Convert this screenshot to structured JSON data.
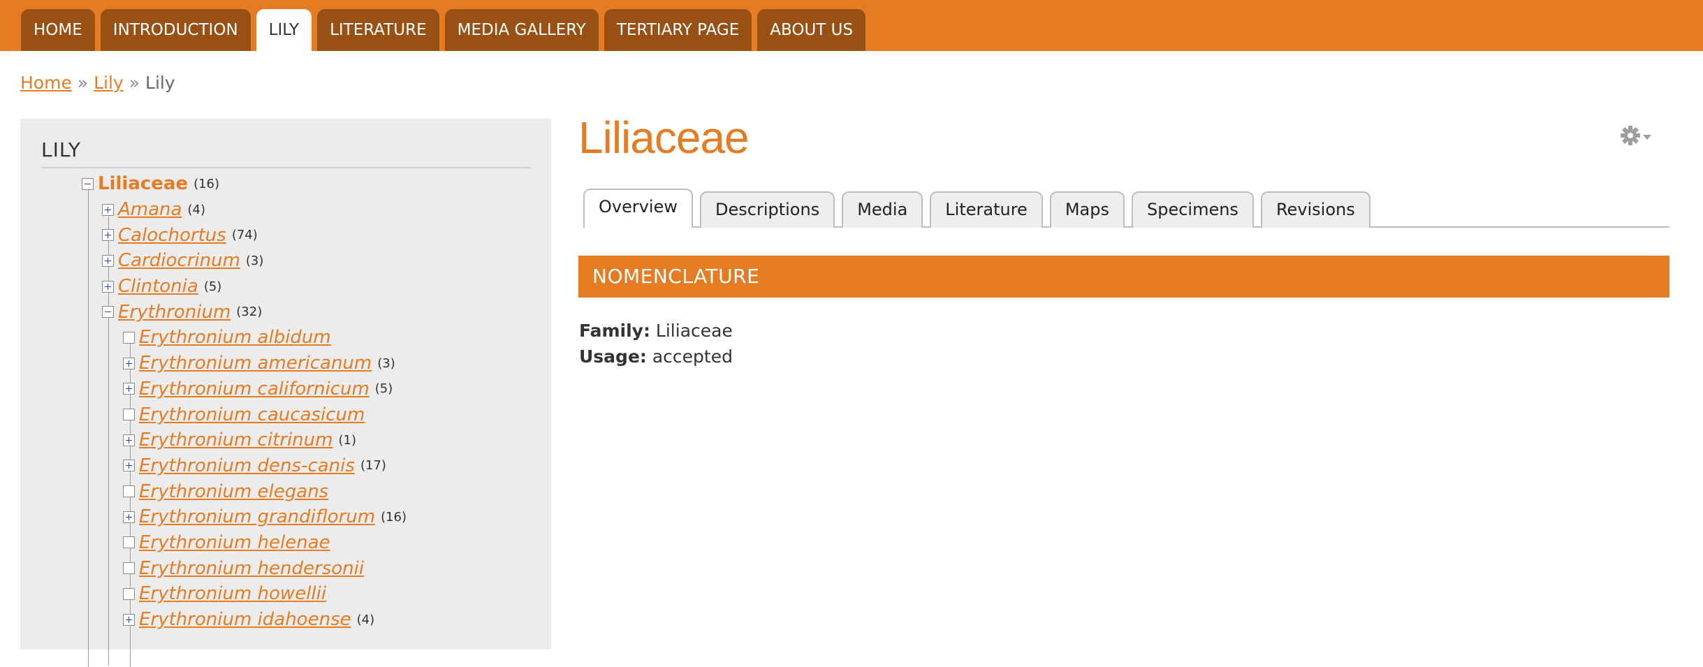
{
  "nav": {
    "tabs": [
      {
        "label": "HOME",
        "active": false
      },
      {
        "label": "INTRODUCTION",
        "active": false
      },
      {
        "label": "LILY",
        "active": true
      },
      {
        "label": "LITERATURE",
        "active": false
      },
      {
        "label": "MEDIA GALLERY",
        "active": false
      },
      {
        "label": "TERTIARY PAGE",
        "active": false
      },
      {
        "label": "ABOUT US",
        "active": false
      }
    ]
  },
  "breadcrumb": {
    "home": "Home",
    "lily_link": "Lily",
    "sep": "»",
    "current": "Lily"
  },
  "tree": {
    "title": "LILY",
    "root": {
      "label": "Liliaceae",
      "count": "(16)",
      "expander": "minus"
    },
    "genera": [
      {
        "label": "Amana",
        "count": "(4)",
        "expander": "plus"
      },
      {
        "label": "Calochortus",
        "count": "(74)",
        "expander": "plus"
      },
      {
        "label": "Cardiocrinum",
        "count": "(3)",
        "expander": "plus"
      },
      {
        "label": "Clintonia",
        "count": "(5)",
        "expander": "plus"
      },
      {
        "label": "Erythronium",
        "count": "(32)",
        "expander": "minus"
      }
    ],
    "species": [
      {
        "label": "Erythronium albidum",
        "count": "",
        "expander": "leaf"
      },
      {
        "label": "Erythronium americanum",
        "count": "(3)",
        "expander": "plus"
      },
      {
        "label": "Erythronium californicum",
        "count": "(5)",
        "expander": "plus"
      },
      {
        "label": "Erythronium caucasicum",
        "count": "",
        "expander": "leaf"
      },
      {
        "label": "Erythronium citrinum",
        "count": "(1)",
        "expander": "plus"
      },
      {
        "label": "Erythronium dens-canis",
        "count": "(17)",
        "expander": "plus"
      },
      {
        "label": "Erythronium elegans",
        "count": "",
        "expander": "leaf"
      },
      {
        "label": "Erythronium grandiflorum",
        "count": "(16)",
        "expander": "plus"
      },
      {
        "label": "Erythronium helenae",
        "count": "",
        "expander": "leaf"
      },
      {
        "label": "Erythronium hendersonii",
        "count": "",
        "expander": "leaf"
      },
      {
        "label": "Erythronium howellii",
        "count": "",
        "expander": "leaf"
      },
      {
        "label": "Erythronium idahoense",
        "count": "(4)",
        "expander": "plus"
      }
    ]
  },
  "main": {
    "title": "Liliaceae",
    "gear_icon": "gear-icon",
    "tabs": [
      {
        "label": "Overview",
        "active": true
      },
      {
        "label": "Descriptions",
        "active": false
      },
      {
        "label": "Media",
        "active": false
      },
      {
        "label": "Literature",
        "active": false
      },
      {
        "label": "Maps",
        "active": false
      },
      {
        "label": "Specimens",
        "active": false
      },
      {
        "label": "Revisions",
        "active": false
      }
    ],
    "section_heading": "NOMENCLATURE",
    "fields": [
      {
        "label": "Family:",
        "value": "Liliaceae"
      },
      {
        "label": "Usage:",
        "value": "accepted"
      }
    ]
  },
  "colors": {
    "accent": "#e57c24",
    "nav_tab": "#985014",
    "panel_bg": "#ececec",
    "expander_glyph": "#2a46b0"
  }
}
